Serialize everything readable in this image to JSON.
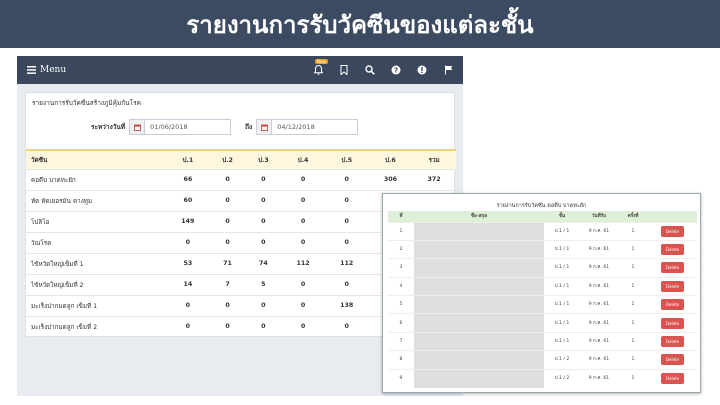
{
  "slide": {
    "title": "รายงานการรับวัคซีนของแต่ละชั้น"
  },
  "navbar": {
    "menu_label": "Menu",
    "new_badge": "New",
    "icons": [
      "bell-icon",
      "bookmark-icon",
      "search-icon",
      "help-icon",
      "info-icon",
      "flag-icon"
    ]
  },
  "panel": {
    "title": "รายงานการรับวัคซีนสร้างภูมิคุ้มกันโรค",
    "from_label": "ระหว่างวันที่",
    "from_date": "01/06/2018",
    "to_label": "ถึง",
    "to_date": "04/12/2018"
  },
  "table": {
    "headers": [
      "วัคซีน",
      "ป.1",
      "ป.2",
      "ป.3",
      "ป.4",
      "ป.5",
      "ป.6",
      "รวม"
    ],
    "rows": [
      [
        "คอตีบ บาดทะยัก",
        "66",
        "0",
        "0",
        "0",
        "0",
        "306",
        "372"
      ],
      [
        "หัด หัดเยอรมัน คางทูม",
        "60",
        "0",
        "0",
        "0",
        "0",
        "",
        ""
      ],
      [
        "โปลิโอ",
        "149",
        "0",
        "0",
        "0",
        "0",
        "",
        ""
      ],
      [
        "วัณโรค",
        "0",
        "0",
        "0",
        "0",
        "0",
        "",
        ""
      ],
      [
        "ไข้หวัดใหญ่เข็มที่ 1",
        "53",
        "71",
        "74",
        "112",
        "112",
        "",
        ""
      ],
      [
        "ไข้หวัดใหญ่เข็มที่ 2",
        "14",
        "7",
        "5",
        "0",
        "0",
        "",
        ""
      ],
      [
        "มะเร็งปากมดลูก เข็มที่ 1",
        "0",
        "0",
        "0",
        "0",
        "138",
        "",
        ""
      ],
      [
        "มะเร็งปากมดลูก เข็มที่ 2",
        "0",
        "0",
        "0",
        "0",
        "0",
        "",
        ""
      ]
    ]
  },
  "overlay": {
    "title": "รายงานการรับวัคซีน คอตีบ บาดทะยัก",
    "headers": [
      "ที่",
      "ชื่อ-สกุล",
      "ชั้น",
      "วันที่รับ",
      "ครั้งที่",
      ""
    ],
    "delete_label": "Delete",
    "rows": [
      [
        "1",
        "ป.1 / 1",
        "9 ก.ค. 61",
        "1"
      ],
      [
        "2",
        "ป.1 / 1",
        "9 ก.ค. 61",
        "1"
      ],
      [
        "3",
        "ป.1 / 1",
        "9 ก.ค. 61",
        "1"
      ],
      [
        "4",
        "ป.1 / 1",
        "9 ก.ค. 61",
        "1"
      ],
      [
        "5",
        "ป.1 / 1",
        "9 ก.ค. 61",
        "1"
      ],
      [
        "6",
        "ป.1 / 1",
        "9 ก.ค. 61",
        "1"
      ],
      [
        "7",
        "ป.1 / 1",
        "9 ก.ค. 61",
        "1"
      ],
      [
        "8",
        "ป.1 / 2",
        "9 ก.ค. 61",
        "1"
      ],
      [
        "9",
        "ป.1 / 2",
        "9 ก.ค. 61",
        "1"
      ]
    ]
  }
}
